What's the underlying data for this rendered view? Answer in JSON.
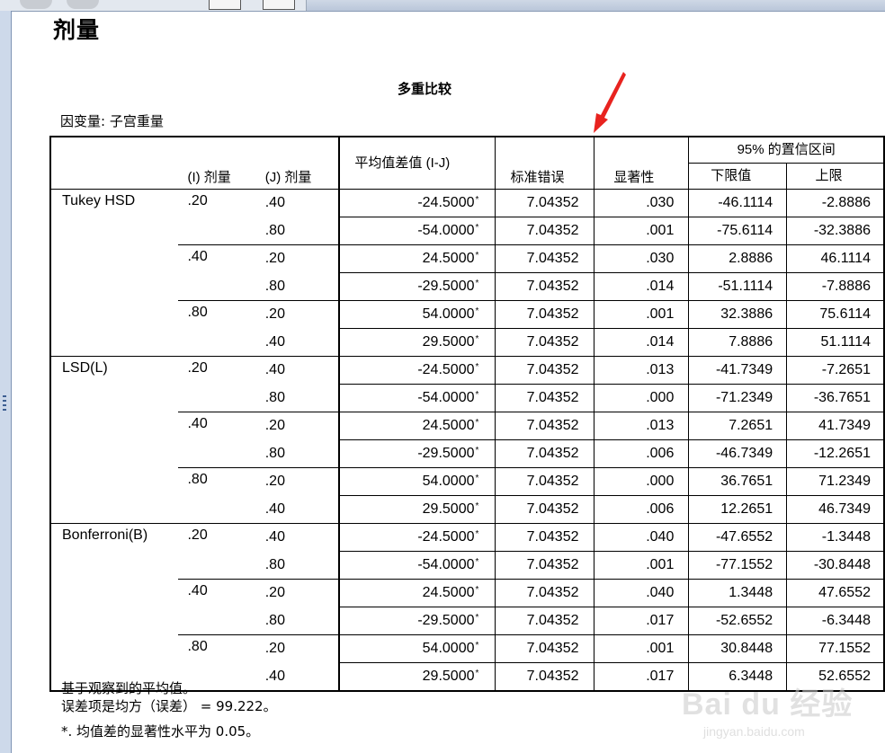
{
  "section_title": "剂量",
  "table_title": "多重比较",
  "dependent_variable": "因变量:   子宫重量",
  "headers": {
    "diff": "平均值差值 (I-J)",
    "se": "标准错误",
    "sig": "显著性",
    "ci": "95% 的置信区间",
    "i": "(I) 剂量",
    "j": "(J) 剂量",
    "lower": "下限值",
    "upper": "上限"
  },
  "star_mark": "*",
  "methods": [
    {
      "name": "Tukey HSD",
      "groups": [
        {
          "i": ".20",
          "rows": [
            {
              "j": ".40",
              "diff": "-24.5000",
              "se": "7.04352",
              "sig": ".030",
              "lower": "-46.1114",
              "upper": "-2.8886"
            },
            {
              "j": ".80",
              "diff": "-54.0000",
              "se": "7.04352",
              "sig": ".001",
              "lower": "-75.6114",
              "upper": "-32.3886"
            }
          ]
        },
        {
          "i": ".40",
          "rows": [
            {
              "j": ".20",
              "diff": "24.5000",
              "se": "7.04352",
              "sig": ".030",
              "lower": "2.8886",
              "upper": "46.1114"
            },
            {
              "j": ".80",
              "diff": "-29.5000",
              "se": "7.04352",
              "sig": ".014",
              "lower": "-51.1114",
              "upper": "-7.8886"
            }
          ]
        },
        {
          "i": ".80",
          "rows": [
            {
              "j": ".20",
              "diff": "54.0000",
              "se": "7.04352",
              "sig": ".001",
              "lower": "32.3886",
              "upper": "75.6114"
            },
            {
              "j": ".40",
              "diff": "29.5000",
              "se": "7.04352",
              "sig": ".014",
              "lower": "7.8886",
              "upper": "51.1114"
            }
          ]
        }
      ]
    },
    {
      "name": "LSD(L)",
      "groups": [
        {
          "i": ".20",
          "rows": [
            {
              "j": ".40",
              "diff": "-24.5000",
              "se": "7.04352",
              "sig": ".013",
              "lower": "-41.7349",
              "upper": "-7.2651"
            },
            {
              "j": ".80",
              "diff": "-54.0000",
              "se": "7.04352",
              "sig": ".000",
              "lower": "-71.2349",
              "upper": "-36.7651"
            }
          ]
        },
        {
          "i": ".40",
          "rows": [
            {
              "j": ".20",
              "diff": "24.5000",
              "se": "7.04352",
              "sig": ".013",
              "lower": "7.2651",
              "upper": "41.7349"
            },
            {
              "j": ".80",
              "diff": "-29.5000",
              "se": "7.04352",
              "sig": ".006",
              "lower": "-46.7349",
              "upper": "-12.2651"
            }
          ]
        },
        {
          "i": ".80",
          "rows": [
            {
              "j": ".20",
              "diff": "54.0000",
              "se": "7.04352",
              "sig": ".000",
              "lower": "36.7651",
              "upper": "71.2349"
            },
            {
              "j": ".40",
              "diff": "29.5000",
              "se": "7.04352",
              "sig": ".006",
              "lower": "12.2651",
              "upper": "46.7349"
            }
          ]
        }
      ]
    },
    {
      "name": "Bonferroni(B)",
      "groups": [
        {
          "i": ".20",
          "rows": [
            {
              "j": ".40",
              "diff": "-24.5000",
              "se": "7.04352",
              "sig": ".040",
              "lower": "-47.6552",
              "upper": "-1.3448"
            },
            {
              "j": ".80",
              "diff": "-54.0000",
              "se": "7.04352",
              "sig": ".001",
              "lower": "-77.1552",
              "upper": "-30.8448"
            }
          ]
        },
        {
          "i": ".40",
          "rows": [
            {
              "j": ".20",
              "diff": "24.5000",
              "se": "7.04352",
              "sig": ".040",
              "lower": "1.3448",
              "upper": "47.6552"
            },
            {
              "j": ".80",
              "diff": "-29.5000",
              "se": "7.04352",
              "sig": ".017",
              "lower": "-52.6552",
              "upper": "-6.3448"
            }
          ]
        },
        {
          "i": ".80",
          "rows": [
            {
              "j": ".20",
              "diff": "54.0000",
              "se": "7.04352",
              "sig": ".001",
              "lower": "30.8448",
              "upper": "77.1552"
            },
            {
              "j": ".40",
              "diff": "29.5000",
              "se": "7.04352",
              "sig": ".017",
              "lower": "6.3448",
              "upper": "52.6552"
            }
          ]
        }
      ]
    }
  ],
  "notes": {
    "line1": "基于观察到的平均值。",
    "line2": " 误差项是均方（误差） = 99.222。",
    "line3": "*. 均值差的显著性水平为 0.05。"
  },
  "watermark": {
    "main": "Bai du 经验",
    "url": "jingyan.baidu.com"
  },
  "colors": {
    "arrow": "#e8231f",
    "frame": "#cdd9ea",
    "frame_border": "#7f95b5"
  }
}
